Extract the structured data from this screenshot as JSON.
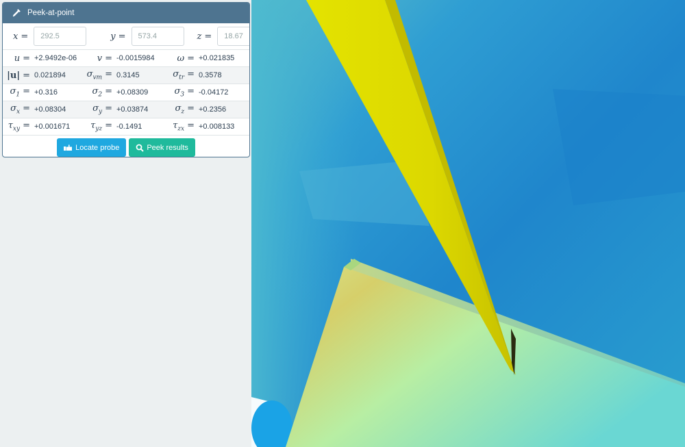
{
  "panel": {
    "title": "Peek-at-point",
    "header_icon": "eyedropper-icon"
  },
  "coords": [
    {
      "var": "x",
      "value": "292.5"
    },
    {
      "var": "y",
      "value": "573.4"
    },
    {
      "var": "z",
      "value": "18.67"
    }
  ],
  "results": [
    [
      {
        "sym": "u",
        "sub": "",
        "value": "+2.9492e-06"
      },
      {
        "sym": "v",
        "sub": "",
        "value": "-0.0015984"
      },
      {
        "sym": "ω",
        "sub": "",
        "value": "+0.021835"
      }
    ],
    [
      {
        "sym": "|u|",
        "sub": "",
        "value": "0.021894"
      },
      {
        "sym": "σ",
        "sub": "vm",
        "value": "0.3145"
      },
      {
        "sym": "σ",
        "sub": "tr",
        "value": "0.3578"
      }
    ],
    [
      {
        "sym": "σ",
        "sub": "1",
        "value": "+0.316"
      },
      {
        "sym": "σ",
        "sub": "2",
        "value": "+0.08309"
      },
      {
        "sym": "σ",
        "sub": "3",
        "value": "-0.04172"
      }
    ],
    [
      {
        "sym": "σ",
        "sub": "x",
        "value": "+0.08304"
      },
      {
        "sym": "σ",
        "sub": "y",
        "value": "+0.03874"
      },
      {
        "sym": "σ",
        "sub": "z",
        "value": "+0.2356"
      }
    ],
    [
      {
        "sym": "τ",
        "sub": "xy",
        "value": "+0.001671"
      },
      {
        "sym": "τ",
        "sub": "yz",
        "value": "-0.1491"
      },
      {
        "sym": "τ",
        "sub": "zx",
        "value": "+0.008133"
      }
    ]
  ],
  "buttons": {
    "locate": {
      "label": "Locate probe",
      "icon": "hand-pointer-icon",
      "color": "#1fa8e0"
    },
    "peek": {
      "label": "Peek results",
      "icon": "search-icon",
      "color": "#1fba9c"
    }
  },
  "colors": {
    "panel_header": "#4e7490",
    "sidebar_bg": "#ecf0f1",
    "probe": "#e3e000"
  }
}
